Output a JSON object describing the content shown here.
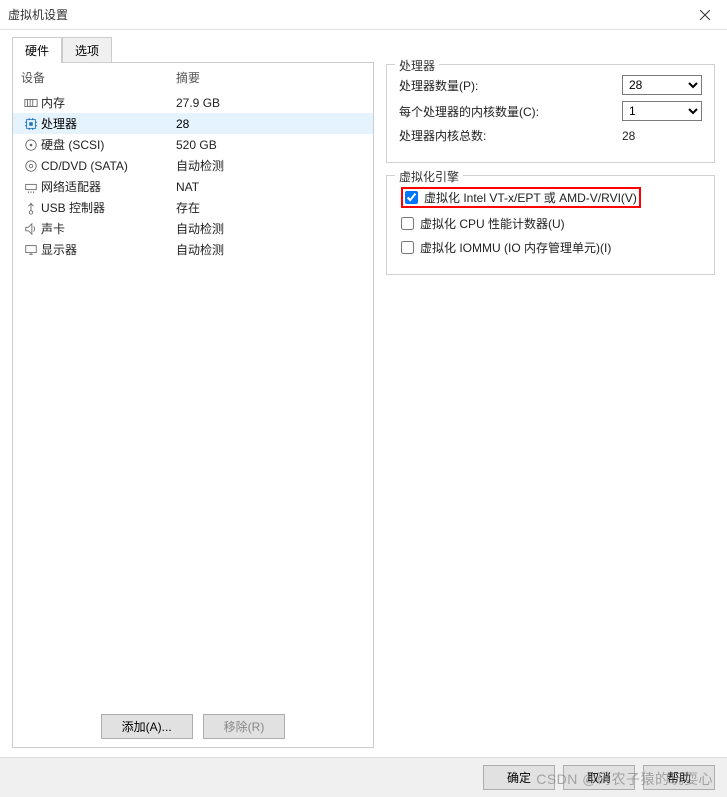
{
  "window": {
    "title": "虚拟机设置"
  },
  "tabs": {
    "hardware": "硬件",
    "options": "选项"
  },
  "hw_header": {
    "device": "设备",
    "summary": "摘要"
  },
  "hardware": [
    {
      "icon": "memory-icon",
      "name": "内存",
      "summary": "27.9 GB",
      "selected": false
    },
    {
      "icon": "cpu-icon",
      "name": "处理器",
      "summary": "28",
      "selected": true
    },
    {
      "icon": "disk-icon",
      "name": "硬盘 (SCSI)",
      "summary": "520 GB",
      "selected": false
    },
    {
      "icon": "cd-icon",
      "name": "CD/DVD (SATA)",
      "summary": "自动检测",
      "selected": false
    },
    {
      "icon": "network-icon",
      "name": "网络适配器",
      "summary": "NAT",
      "selected": false
    },
    {
      "icon": "usb-icon",
      "name": "USB 控制器",
      "summary": "存在",
      "selected": false
    },
    {
      "icon": "sound-icon",
      "name": "声卡",
      "summary": "自动检测",
      "selected": false
    },
    {
      "icon": "display-icon",
      "name": "显示器",
      "summary": "自动检测",
      "selected": false
    }
  ],
  "left_buttons": {
    "add": "添加(A)...",
    "remove": "移除(R)"
  },
  "processor_group": {
    "legend": "处理器",
    "num_processors_label": "处理器数量(P):",
    "num_processors_value": "28",
    "cores_per_label": "每个处理器的内核数量(C):",
    "cores_per_value": "1",
    "total_label": "处理器内核总数:",
    "total_value": "28"
  },
  "virt_group": {
    "legend": "虚拟化引擎",
    "vt_label": "虚拟化 Intel VT-x/EPT 或 AMD-V/RVI(V)",
    "vt_checked": true,
    "perf_label": "虚拟化 CPU 性能计数器(U)",
    "perf_checked": false,
    "iommu_label": "虚拟化 IOMMU (IO 内存管理单元)(I)",
    "iommu_checked": false
  },
  "bottom": {
    "ok": "确定",
    "cancel": "取消",
    "help": "帮助"
  },
  "watermark": "CSDN @码农子猿的玩耍心"
}
